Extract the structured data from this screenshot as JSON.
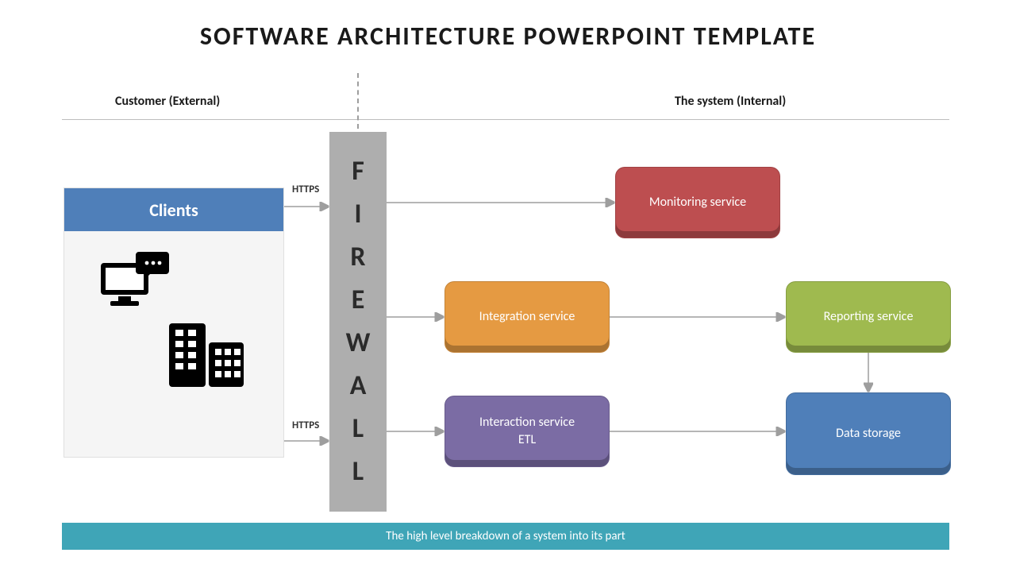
{
  "title": "SOFTWARE ARCHITECTURE POWERPOINT TEMPLATE",
  "section": {
    "external": "Customer (External)",
    "internal": "The system (Internal)"
  },
  "labels": {
    "https1": "HTTPS",
    "https2": "HTTPS"
  },
  "clients": {
    "title": "Clients"
  },
  "firewall": {
    "letters": [
      "F",
      "I",
      "R",
      "E",
      "W",
      "A",
      "L",
      "L"
    ]
  },
  "services": {
    "monitor": "Monitoring service",
    "integrate": "Integration service",
    "reporting": "Reporting service",
    "interact": "Interaction service\nETL",
    "storage": "Data storage"
  },
  "footer": "The high level breakdown of a system into its part"
}
